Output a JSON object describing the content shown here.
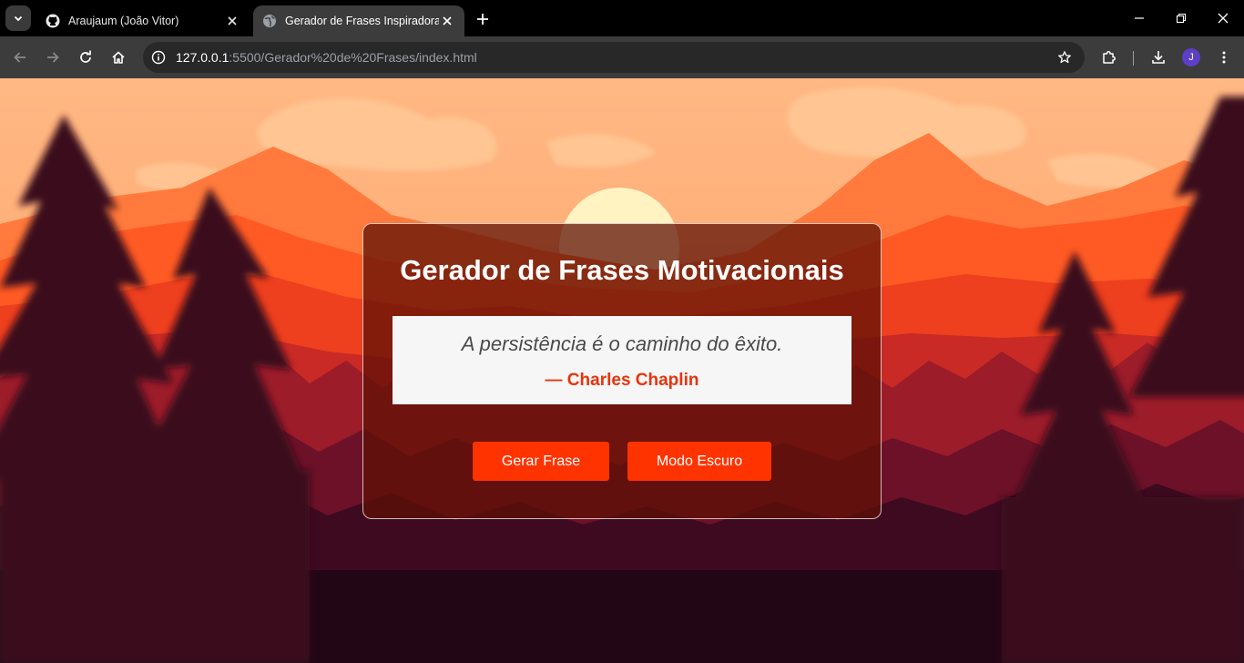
{
  "browser": {
    "tabs": [
      {
        "title": "Araujaum (João Vitor)",
        "icon": "github-icon",
        "active": false
      },
      {
        "title": "Gerador de Frases Inspiradoras",
        "icon": "globe-icon",
        "active": true
      }
    ],
    "url_host": "127.0.0.1",
    "url_rest": ":5500/Gerador%20de%20Frases/index.html",
    "profile_initial": "J"
  },
  "page": {
    "title": "Gerador de Frases Motivacionais",
    "quote": "A persistência é o caminho do êxito.",
    "author": "— Charles Chaplin",
    "buttons": {
      "generate": "Gerar Frase",
      "dark_mode": "Modo Escuro"
    }
  },
  "colors": {
    "accent": "#ff3300",
    "author": "#e8330c",
    "card_bg": "#5e1006",
    "sky": "#ffb27a"
  }
}
